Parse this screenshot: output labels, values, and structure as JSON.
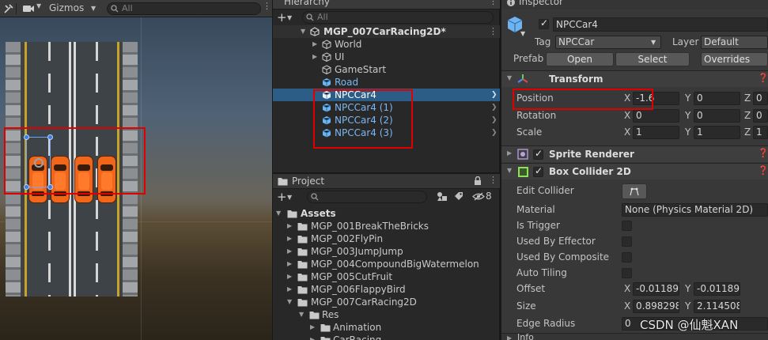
{
  "scene": {
    "gizmos_label": "Gizmos",
    "search_placeholder": "All"
  },
  "hierarchy": {
    "title": "Hierarchy",
    "search_placeholder": "All",
    "scene_name": "MGP_007CarRacing2D*",
    "items": [
      {
        "label": "World"
      },
      {
        "label": "UI"
      },
      {
        "label": "GameStart"
      },
      {
        "label": "Road"
      },
      {
        "label": "NPCCar4"
      },
      {
        "label": "NPCCar4 (1)"
      },
      {
        "label": "NPCCar4 (2)"
      },
      {
        "label": "NPCCar4 (3)"
      }
    ]
  },
  "project": {
    "title": "Project",
    "hidden_count": "8",
    "items": [
      {
        "label": "Assets"
      },
      {
        "label": "MGP_001BreakTheBricks"
      },
      {
        "label": "MGP_002FlyPin"
      },
      {
        "label": "MGP_003JumpJump"
      },
      {
        "label": "MGP_004CompoundBigWatermelon"
      },
      {
        "label": "MGP_005CutFruit"
      },
      {
        "label": "MGP_006FlappyBird"
      },
      {
        "label": "MGP_007CarRacing2D"
      },
      {
        "label": "Res"
      },
      {
        "label": "Animation"
      },
      {
        "label": "CarRacing"
      }
    ]
  },
  "inspector": {
    "title": "Inspector",
    "object_name": "NPCCar4",
    "tag_label": "Tag",
    "tag_value": "NPCCar",
    "layer_label": "Layer",
    "layer_value": "Default",
    "prefab_label": "Prefab",
    "open_button": "Open",
    "select_button": "Select",
    "overrides_button": "Overrides",
    "transform": {
      "title": "Transform",
      "position_label": "Position",
      "rotation_label": "Rotation",
      "scale_label": "Scale",
      "x": "X",
      "y": "Y",
      "z": "Z",
      "position": {
        "x": "-1.6",
        "y": "0",
        "z": "0"
      },
      "rotation": {
        "x": "0",
        "y": "0",
        "z": "0"
      },
      "scale": {
        "x": "1",
        "y": "1",
        "z": "1"
      }
    },
    "sprite_renderer": {
      "title": "Sprite Renderer"
    },
    "box_collider": {
      "title": "Box Collider 2D",
      "edit_collider_label": "Edit Collider",
      "material_label": "Material",
      "material_value": "None (Physics Material 2D)",
      "is_trigger_label": "Is Trigger",
      "used_by_effector_label": "Used By Effector",
      "used_by_composite_label": "Used By Composite",
      "auto_tiling_label": "Auto Tiling",
      "offset_label": "Offset",
      "offset": {
        "x": "-0.011895",
        "y": "-0.011895"
      },
      "size_label": "Size",
      "size": {
        "x": "0.8982983",
        "y": "2.114508"
      },
      "edge_radius_label": "Edge Radius",
      "edge_radius_value": "0"
    },
    "info_label": "Info"
  },
  "watermark": "CSDN @仙魁XAN",
  "colors": {
    "selection": "#2c5d87",
    "prefab_blue": "#7bb8f0",
    "highlight_red": "#e00000",
    "car_orange": "#f0661b"
  }
}
